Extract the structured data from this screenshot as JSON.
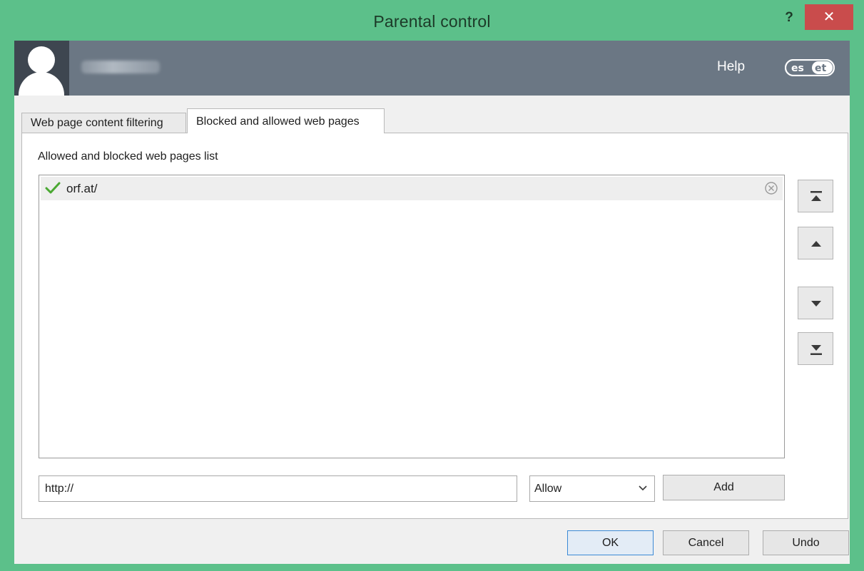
{
  "window": {
    "title": "Parental control",
    "help_glyph": "?",
    "close_glyph": "✕"
  },
  "header": {
    "help_label": "Help",
    "logo_text": "eset",
    "avatar_icon": "user-silhouette-icon"
  },
  "tabs": [
    {
      "label": "Web page content filtering",
      "active": false
    },
    {
      "label": "Blocked and allowed web pages",
      "active": true
    }
  ],
  "list": {
    "label": "Allowed and blocked web pages list",
    "items": [
      {
        "url": "orf.at/",
        "status": "allowed",
        "status_icon": "checkmark-icon",
        "remove_icon": "remove-circle-icon"
      }
    ]
  },
  "side_buttons": [
    {
      "name": "move-to-top",
      "icon": "move-to-top-icon"
    },
    {
      "name": "move-up",
      "icon": "move-up-icon"
    },
    {
      "name": "move-down",
      "icon": "move-down-icon"
    },
    {
      "name": "move-to-bottom",
      "icon": "move-to-bottom-icon"
    }
  ],
  "add_form": {
    "url_value": "http://",
    "action_selected": "Allow",
    "add_label": "Add"
  },
  "footer": {
    "ok_label": "OK",
    "cancel_label": "Cancel",
    "undo_label": "Undo"
  },
  "colors": {
    "title_bar": "#5cc08a",
    "header_bg": "#6b7784",
    "close_button": "#c94c4c",
    "check_green": "#4aa832"
  }
}
